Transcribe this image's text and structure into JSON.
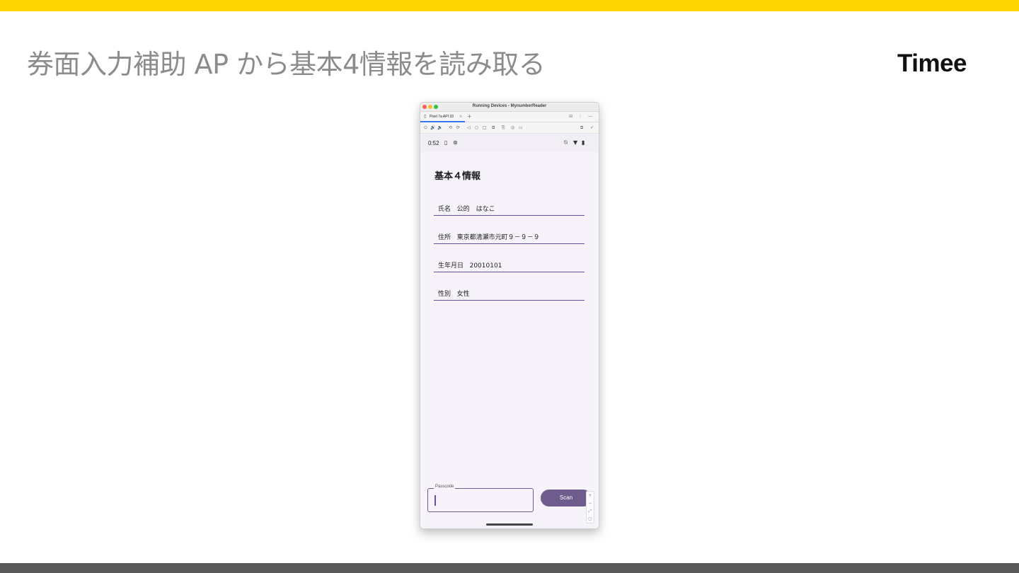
{
  "slide": {
    "title": "券面入力補助 AP から基本4情報を読み取る",
    "logo": "Timee"
  },
  "window": {
    "title": "Running Devices - MynumberReader",
    "tab_label": "Pixel 7a API 33",
    "tab_close": "×",
    "tab_add": "+",
    "right_icons": "⊟ ⋮ —"
  },
  "toolbar": {
    "icons": [
      "power-icon",
      "volume-up-icon",
      "volume-down-icon",
      "rotate-left-icon",
      "rotate-right-icon",
      "back-icon",
      "home-icon",
      "overview-icon",
      "snapshot-icon",
      "screenshot-icon",
      "camera-icon",
      "record-icon"
    ],
    "glyphs": [
      "⏻",
      "🔊",
      "🔉",
      "⟲",
      "⟳",
      "◁",
      "○",
      "□",
      "⧉",
      "⎘",
      "◎",
      "▭"
    ]
  },
  "status": {
    "time": "0:52"
  },
  "app": {
    "title": "基本４情報",
    "fields": [
      {
        "label": "氏名",
        "value": "公的　はなこ"
      },
      {
        "label": "住所",
        "value": "東京都清瀬市元町９－９－９"
      },
      {
        "label": "生年月日",
        "value": "20010101"
      },
      {
        "label": "性別",
        "value": "女性"
      }
    ],
    "passcode_label": "Passcode",
    "passcode_value": "",
    "scan_label": "Scan"
  },
  "colors": {
    "accent_bar": "#ffd600",
    "primary": "#6e5d8c",
    "underline": "#6750a4"
  }
}
